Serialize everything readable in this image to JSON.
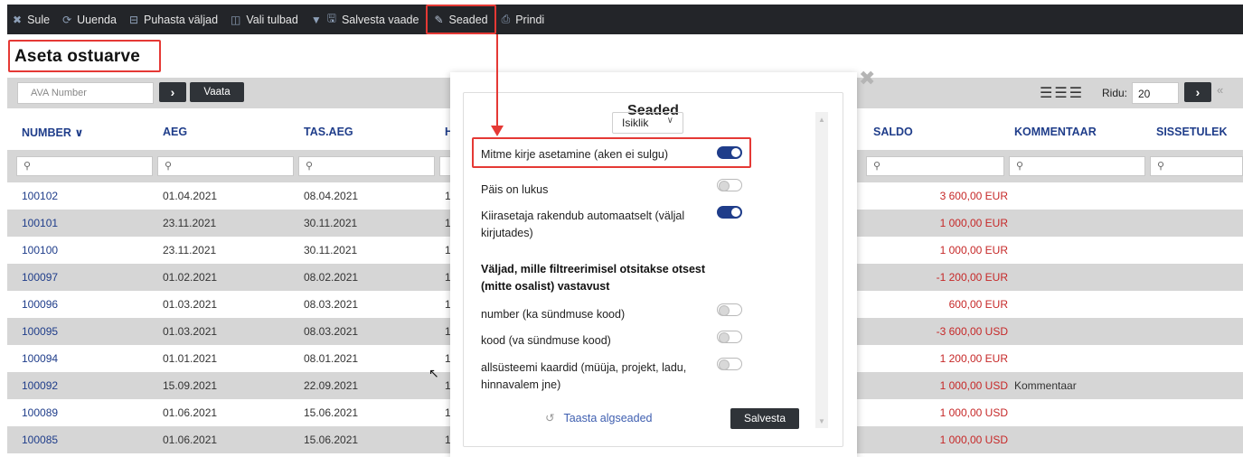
{
  "toolbar": {
    "items": [
      {
        "label": "Sule",
        "icon": "close-icon",
        "glyph": "✖"
      },
      {
        "label": "Uuenda",
        "icon": "refresh-icon",
        "glyph": "⟳"
      },
      {
        "label": "Puhasta väljad",
        "icon": "clear-icon",
        "glyph": "⊟"
      },
      {
        "label": "Vali tulbad",
        "icon": "columns-icon",
        "glyph": "◫"
      },
      {
        "label": "Salvesta vaade",
        "icon": "save-icon",
        "glyph": "▼ 🖫"
      },
      {
        "label": "Seaded",
        "icon": "wrench-icon",
        "glyph": "🔧"
      },
      {
        "label": "Prindi",
        "icon": "print-icon",
        "glyph": "⎙"
      }
    ]
  },
  "page": {
    "title": "Aseta ostuarve"
  },
  "search": {
    "placeholder": "AVA Number",
    "go": "›",
    "view_label": "Vaata"
  },
  "pager": {
    "rows_label": "Ridu:",
    "rows_value": "20",
    "next": "›",
    "last": "«"
  },
  "table": {
    "headers": [
      "NUMBER ∨",
      "AEG",
      "TAS.AEG",
      "H",
      "SALDO",
      "KOMMENTAAR",
      "SISSETULEK"
    ],
    "filter_glyph": "⚲",
    "rows": [
      {
        "number": "100102",
        "aeg": "01.04.2021",
        "tas": "08.04.2021",
        "h": "1",
        "saldo": "3 600,00 EUR",
        "kommentaar": ""
      },
      {
        "number": "100101",
        "aeg": "23.11.2021",
        "tas": "30.11.2021",
        "h": "1",
        "saldo": "1 000,00 EUR",
        "kommentaar": ""
      },
      {
        "number": "100100",
        "aeg": "23.11.2021",
        "tas": "30.11.2021",
        "h": "1",
        "saldo": "1 000,00 EUR",
        "kommentaar": ""
      },
      {
        "number": "100097",
        "aeg": "01.02.2021",
        "tas": "08.02.2021",
        "h": "1",
        "saldo": "-1 200,00 EUR",
        "kommentaar": ""
      },
      {
        "number": "100096",
        "aeg": "01.03.2021",
        "tas": "08.03.2021",
        "h": "1",
        "saldo": "600,00 EUR",
        "kommentaar": ""
      },
      {
        "number": "100095",
        "aeg": "01.03.2021",
        "tas": "08.03.2021",
        "h": "1",
        "saldo": "-3 600,00 USD",
        "kommentaar": ""
      },
      {
        "number": "100094",
        "aeg": "01.01.2021",
        "tas": "08.01.2021",
        "h": "1",
        "saldo": "1 200,00 EUR",
        "kommentaar": ""
      },
      {
        "number": "100092",
        "aeg": "15.09.2021",
        "tas": "22.09.2021",
        "h": "1",
        "saldo": "1 000,00 USD",
        "kommentaar": "Kommentaar"
      },
      {
        "number": "100089",
        "aeg": "01.06.2021",
        "tas": "15.06.2021",
        "h": "1",
        "saldo": "1 000,00 USD",
        "kommentaar": ""
      },
      {
        "number": "100085",
        "aeg": "01.06.2021",
        "tas": "15.06.2021",
        "h": "1",
        "saldo": "1 000,00 USD",
        "kommentaar": ""
      }
    ]
  },
  "modal": {
    "title": "Seaded",
    "close": "✖",
    "scope_select": "Isiklik",
    "settings": [
      {
        "label": "Mitme kirje asetamine (aken ei sulgu)",
        "on": true
      },
      {
        "label": "Päis on lukus",
        "on": false
      },
      {
        "label": "Kiirasetaja rakendub automaatselt (väljal kirjutades)",
        "on": true
      }
    ],
    "exact_heading": "Väljad, mille filtreerimisel otsitakse otsest (mitte osalist) vastavust",
    "exact_settings": [
      {
        "label": "number (ka sündmuse kood)",
        "on": false
      },
      {
        "label": "kood (va sündmuse kood)",
        "on": false
      },
      {
        "label": "allsüsteemi kaardid (müüja, projekt, ladu, hinnavalem jne)",
        "on": false
      }
    ],
    "reset_label": "Taasta algseaded",
    "save_label": "Salvesta"
  },
  "colors": {
    "toolbar_bg": "#232529",
    "link": "#1f3d8a",
    "negative_red": "#c62828",
    "highlight": "#e53935",
    "toggle_on": "#1f3d8a"
  }
}
